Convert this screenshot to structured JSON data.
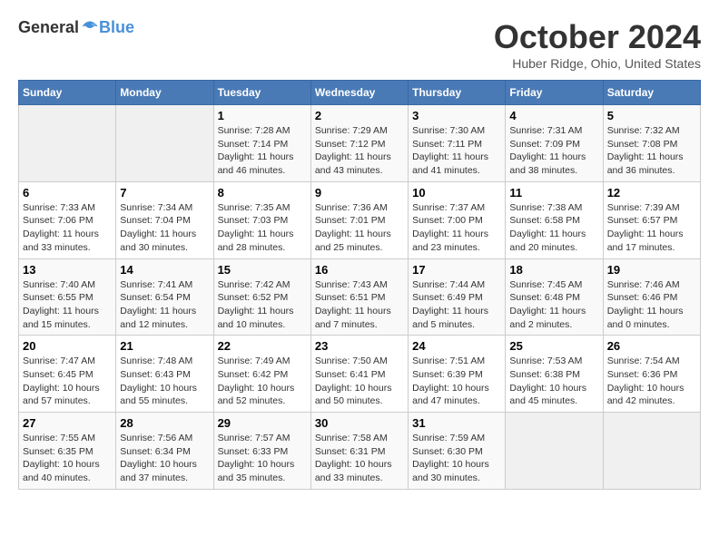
{
  "header": {
    "logo_general": "General",
    "logo_blue": "Blue",
    "title": "October 2024",
    "location": "Huber Ridge, Ohio, United States"
  },
  "days_of_week": [
    "Sunday",
    "Monday",
    "Tuesday",
    "Wednesday",
    "Thursday",
    "Friday",
    "Saturday"
  ],
  "weeks": [
    [
      {
        "day": "",
        "info": ""
      },
      {
        "day": "",
        "info": ""
      },
      {
        "day": "1",
        "info": "Sunrise: 7:28 AM\nSunset: 7:14 PM\nDaylight: 11 hours\nand 46 minutes."
      },
      {
        "day": "2",
        "info": "Sunrise: 7:29 AM\nSunset: 7:12 PM\nDaylight: 11 hours\nand 43 minutes."
      },
      {
        "day": "3",
        "info": "Sunrise: 7:30 AM\nSunset: 7:11 PM\nDaylight: 11 hours\nand 41 minutes."
      },
      {
        "day": "4",
        "info": "Sunrise: 7:31 AM\nSunset: 7:09 PM\nDaylight: 11 hours\nand 38 minutes."
      },
      {
        "day": "5",
        "info": "Sunrise: 7:32 AM\nSunset: 7:08 PM\nDaylight: 11 hours\nand 36 minutes."
      }
    ],
    [
      {
        "day": "6",
        "info": "Sunrise: 7:33 AM\nSunset: 7:06 PM\nDaylight: 11 hours\nand 33 minutes."
      },
      {
        "day": "7",
        "info": "Sunrise: 7:34 AM\nSunset: 7:04 PM\nDaylight: 11 hours\nand 30 minutes."
      },
      {
        "day": "8",
        "info": "Sunrise: 7:35 AM\nSunset: 7:03 PM\nDaylight: 11 hours\nand 28 minutes."
      },
      {
        "day": "9",
        "info": "Sunrise: 7:36 AM\nSunset: 7:01 PM\nDaylight: 11 hours\nand 25 minutes."
      },
      {
        "day": "10",
        "info": "Sunrise: 7:37 AM\nSunset: 7:00 PM\nDaylight: 11 hours\nand 23 minutes."
      },
      {
        "day": "11",
        "info": "Sunrise: 7:38 AM\nSunset: 6:58 PM\nDaylight: 11 hours\nand 20 minutes."
      },
      {
        "day": "12",
        "info": "Sunrise: 7:39 AM\nSunset: 6:57 PM\nDaylight: 11 hours\nand 17 minutes."
      }
    ],
    [
      {
        "day": "13",
        "info": "Sunrise: 7:40 AM\nSunset: 6:55 PM\nDaylight: 11 hours\nand 15 minutes."
      },
      {
        "day": "14",
        "info": "Sunrise: 7:41 AM\nSunset: 6:54 PM\nDaylight: 11 hours\nand 12 minutes."
      },
      {
        "day": "15",
        "info": "Sunrise: 7:42 AM\nSunset: 6:52 PM\nDaylight: 11 hours\nand 10 minutes."
      },
      {
        "day": "16",
        "info": "Sunrise: 7:43 AM\nSunset: 6:51 PM\nDaylight: 11 hours\nand 7 minutes."
      },
      {
        "day": "17",
        "info": "Sunrise: 7:44 AM\nSunset: 6:49 PM\nDaylight: 11 hours\nand 5 minutes."
      },
      {
        "day": "18",
        "info": "Sunrise: 7:45 AM\nSunset: 6:48 PM\nDaylight: 11 hours\nand 2 minutes."
      },
      {
        "day": "19",
        "info": "Sunrise: 7:46 AM\nSunset: 6:46 PM\nDaylight: 11 hours\nand 0 minutes."
      }
    ],
    [
      {
        "day": "20",
        "info": "Sunrise: 7:47 AM\nSunset: 6:45 PM\nDaylight: 10 hours\nand 57 minutes."
      },
      {
        "day": "21",
        "info": "Sunrise: 7:48 AM\nSunset: 6:43 PM\nDaylight: 10 hours\nand 55 minutes."
      },
      {
        "day": "22",
        "info": "Sunrise: 7:49 AM\nSunset: 6:42 PM\nDaylight: 10 hours\nand 52 minutes."
      },
      {
        "day": "23",
        "info": "Sunrise: 7:50 AM\nSunset: 6:41 PM\nDaylight: 10 hours\nand 50 minutes."
      },
      {
        "day": "24",
        "info": "Sunrise: 7:51 AM\nSunset: 6:39 PM\nDaylight: 10 hours\nand 47 minutes."
      },
      {
        "day": "25",
        "info": "Sunrise: 7:53 AM\nSunset: 6:38 PM\nDaylight: 10 hours\nand 45 minutes."
      },
      {
        "day": "26",
        "info": "Sunrise: 7:54 AM\nSunset: 6:36 PM\nDaylight: 10 hours\nand 42 minutes."
      }
    ],
    [
      {
        "day": "27",
        "info": "Sunrise: 7:55 AM\nSunset: 6:35 PM\nDaylight: 10 hours\nand 40 minutes."
      },
      {
        "day": "28",
        "info": "Sunrise: 7:56 AM\nSunset: 6:34 PM\nDaylight: 10 hours\nand 37 minutes."
      },
      {
        "day": "29",
        "info": "Sunrise: 7:57 AM\nSunset: 6:33 PM\nDaylight: 10 hours\nand 35 minutes."
      },
      {
        "day": "30",
        "info": "Sunrise: 7:58 AM\nSunset: 6:31 PM\nDaylight: 10 hours\nand 33 minutes."
      },
      {
        "day": "31",
        "info": "Sunrise: 7:59 AM\nSunset: 6:30 PM\nDaylight: 10 hours\nand 30 minutes."
      },
      {
        "day": "",
        "info": ""
      },
      {
        "day": "",
        "info": ""
      }
    ]
  ]
}
